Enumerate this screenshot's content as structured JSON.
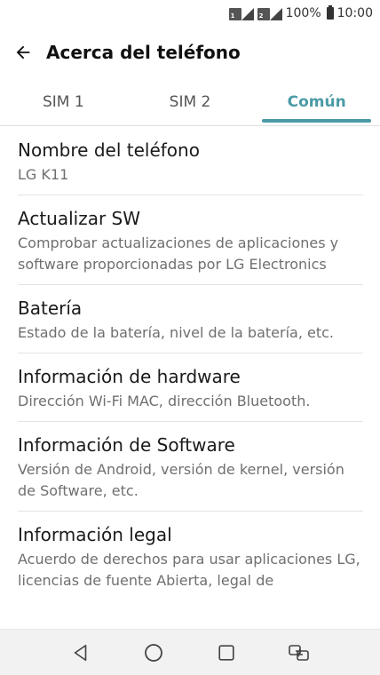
{
  "status_bar": {
    "battery_percent": "100%",
    "time": "10:00"
  },
  "app_bar": {
    "back_icon": "arrow-left-icon",
    "title": "Acerca del teléfono"
  },
  "tabs": [
    {
      "label": "SIM 1",
      "active": false
    },
    {
      "label": "SIM 2",
      "active": false
    },
    {
      "label": "Común",
      "active": true
    }
  ],
  "items": [
    {
      "title": "Nombre del teléfono",
      "subtitle": "LG K11"
    },
    {
      "title": "Actualizar SW",
      "subtitle": "Comprobar actualizaciones de aplicaciones y software proporcionadas por LG Electronics"
    },
    {
      "title": "Batería",
      "subtitle": "Estado de la batería, nivel de la batería, etc."
    },
    {
      "title": "Información de hardware",
      "subtitle": "Dirección Wi-Fi MAC, dirección Bluetooth."
    },
    {
      "title": "Información de Software",
      "subtitle": "Versión de Android, versión de kernel, versión de Software, etc."
    },
    {
      "title": "Información legal",
      "subtitle": "Acuerdo de derechos para usar aplicaciones LG, licencias de fuente Abierta, legal de"
    }
  ],
  "nav_bar": {
    "icons": [
      "back-triangle-icon",
      "home-circle-icon",
      "recents-square-icon",
      "dual-window-icon"
    ]
  },
  "colors": {
    "accent": "#4a9ba6",
    "nav_background": "#f2f2f2"
  }
}
